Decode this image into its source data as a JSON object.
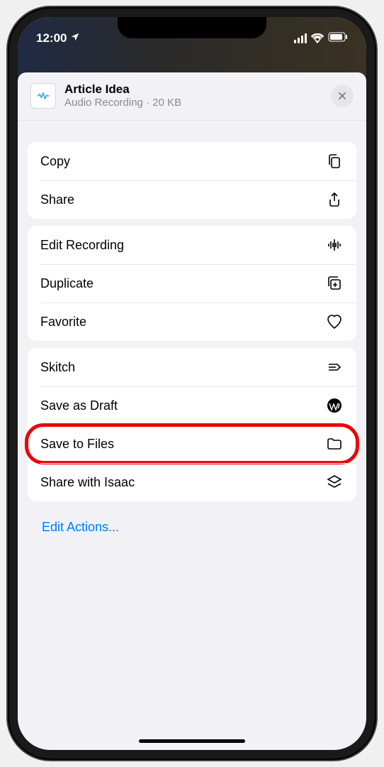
{
  "status": {
    "time": "12:00"
  },
  "header": {
    "title": "Article Idea",
    "subtitle_type": "Audio Recording",
    "subtitle_sep": " · ",
    "subtitle_size": "20 KB"
  },
  "groups": [
    {
      "items": [
        {
          "label": "Copy",
          "icon": "copy-icon"
        },
        {
          "label": "Share",
          "icon": "share-icon"
        }
      ]
    },
    {
      "items": [
        {
          "label": "Edit Recording",
          "icon": "waveform-icon"
        },
        {
          "label": "Duplicate",
          "icon": "duplicate-icon"
        },
        {
          "label": "Favorite",
          "icon": "heart-icon"
        }
      ]
    },
    {
      "items": [
        {
          "label": "Skitch",
          "icon": "skitch-icon"
        },
        {
          "label": "Save as Draft",
          "icon": "wordpress-icon"
        },
        {
          "label": "Save to Files",
          "icon": "folder-icon",
          "highlighted": true
        },
        {
          "label": "Share with Isaac",
          "icon": "layers-icon"
        }
      ]
    }
  ],
  "footer": {
    "edit_actions": "Edit Actions..."
  },
  "colors": {
    "link": "#007aff",
    "highlight": "#e80808"
  }
}
